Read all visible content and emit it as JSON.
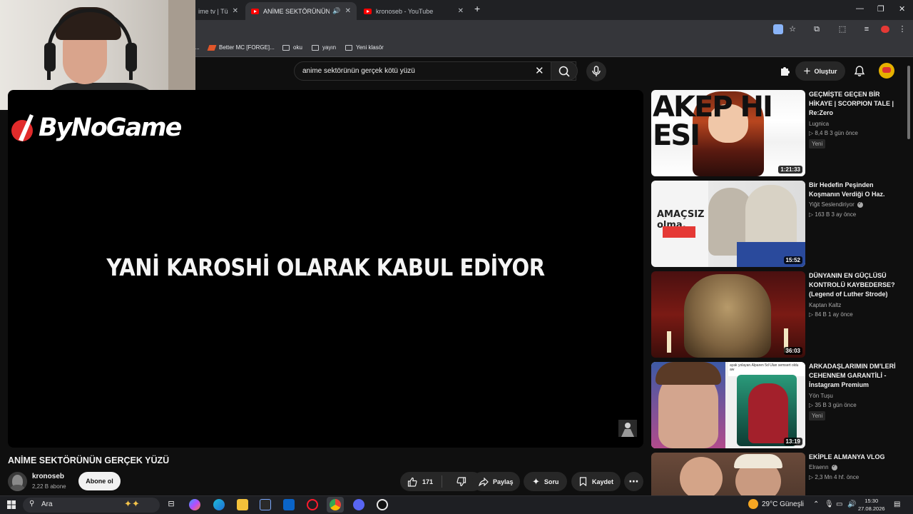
{
  "browser": {
    "tabs": [
      {
        "label": "ime tv | Tür",
        "close": "✕"
      },
      {
        "label": "ANİME SEKTÖRÜNÜN GERÇ",
        "close": "✕"
      },
      {
        "label": "kronoseb - YouTube",
        "close": "✕"
      }
    ],
    "new_tab": "+",
    "window_controls": [
      "—",
      "❐",
      "✕"
    ],
    "bookmarks": [
      {
        "label": "Better MC [FORGE]...",
        "icon": "forge-icon"
      },
      {
        "label": "oku",
        "icon": "folder-icon"
      },
      {
        "label": "yayın",
        "icon": "folder-icon"
      },
      {
        "label": "Yeni klasör",
        "icon": "folder-icon"
      }
    ],
    "bookmark_overflow": "..."
  },
  "youtube": {
    "search_query": "anime sektörünün gerçek kötü yüzü",
    "create_label": "Oluştur"
  },
  "video": {
    "subtitle": "YANİ KAROSHİ OLARAK KABUL EDİYOR",
    "logo_text": "ByNoGame",
    "title": "ANİME SEKTÖRÜNÜN GERÇEK YÜZÜ",
    "channel": "kronoseb",
    "subscribers": "2,22 B abone",
    "subscribe_label": "Abone ol",
    "likes": "171",
    "share_label": "Paylaş",
    "ask_label": "Soru",
    "save_label": "Kaydet"
  },
  "recommendations": [
    {
      "title": "GEÇMİŞTE GEÇEN BİR HİKAYE | SCORPION TALE | Re:Zero",
      "channel": "Lugnica",
      "verified": false,
      "meta": "▷ 8,4 B   3 gün önce",
      "badge": "Yeni",
      "duration": "1:21:33",
      "thumb_text": "AKEP HI ESI"
    },
    {
      "title": "Bir Hedefin Peşinden Koşmanın Verdiği O Haz.",
      "channel": "Yiğit Seslendiriyor",
      "verified": true,
      "meta": "▷ 163 B   3 ay önce",
      "badge": "",
      "duration": "15:52",
      "thumb_text": "AMAÇSIZ olma."
    },
    {
      "title": "DÜNYANIN EN GÜÇLÜSÜ KONTROLÜ KAYBEDERSE? (Legend of Luther Strode)",
      "channel": "Kaptan Kaltz",
      "verified": false,
      "meta": "▷ 84 B   1 ay önce",
      "badge": "",
      "duration": "36:03",
      "thumb_text": ""
    },
    {
      "title": "ARKADAŞLARIMIN DM'LERİ CEHENNEM GARANTİLİ - İnstagram Premium",
      "channel": "Yön Tuşu",
      "verified": false,
      "meta": "▷ 35 B   3 gün önce",
      "badge": "Yeni",
      "duration": "13:19",
      "thumb_text": "ayak yolayan.Alparen 5d Ulan semsert oldu aw"
    },
    {
      "title": "EKİPLE ALMANYA VLOG",
      "channel": "Elraenn",
      "verified": true,
      "meta": "▷ 2,3 Mn   4 hf. önce",
      "badge": "",
      "duration": "",
      "thumb_text": ""
    }
  ],
  "taskbar": {
    "search_placeholder": "Ara",
    "weather": "29°C  Güneşli",
    "time": "15:30",
    "date": "27.08.2026"
  },
  "colors": {
    "background": "#0f0f0f",
    "accent_red": "#ff0000",
    "chip": "#272727"
  }
}
